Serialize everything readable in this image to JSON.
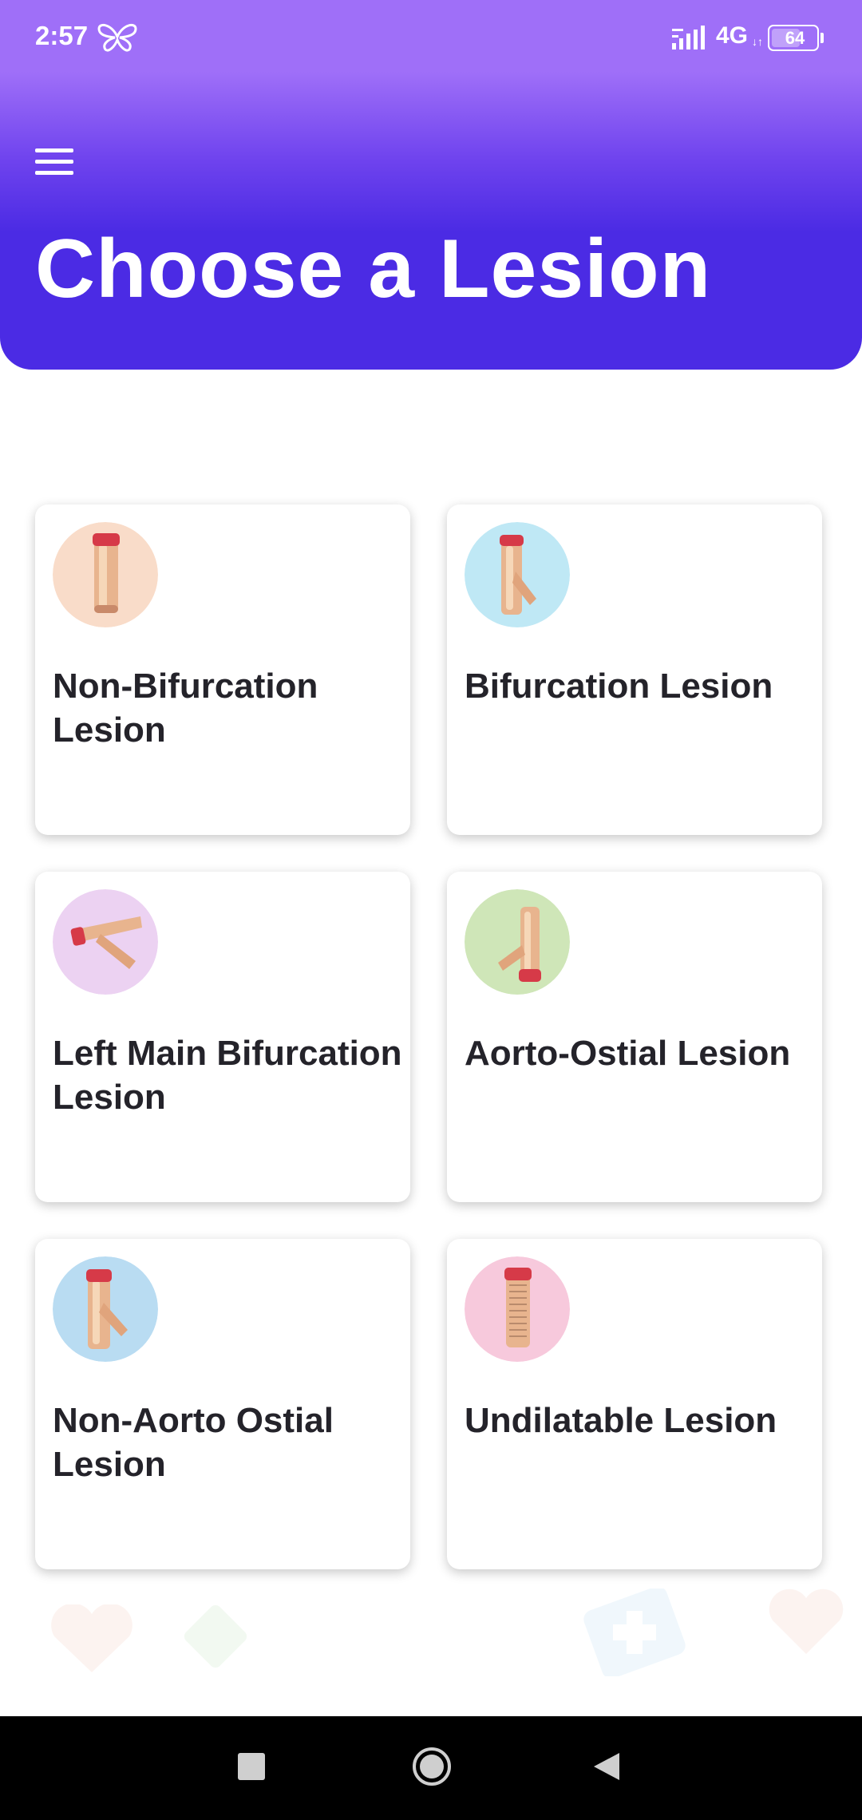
{
  "status_bar": {
    "time": "2:57",
    "network": "4G",
    "network_sub": "↓↑",
    "battery_level": "64",
    "battery_fraction": 0.64
  },
  "header": {
    "menu_icon": "hamburger-menu-icon",
    "title": "Choose a Lesion",
    "gradient_top": "#9f6ff8",
    "gradient_bottom": "#4b2be4"
  },
  "lesions": [
    {
      "label": "Non-Bifurcation Lesion",
      "icon": "straight-vessel-icon",
      "icon_bg": "#f9dcc9"
    },
    {
      "label": "Bifurcation Lesion",
      "icon": "bifurcation-vessel-icon",
      "icon_bg": "#bfe8f5"
    },
    {
      "label": "Left Main Bifurcation Lesion",
      "icon": "left-main-vessel-icon",
      "icon_bg": "#ecd2f2"
    },
    {
      "label": "Aorto-Ostial Lesion",
      "icon": "aorto-ostial-vessel-icon",
      "icon_bg": "#cfe6b8"
    },
    {
      "label": "Non-Aorto Ostial Lesion",
      "icon": "non-aorto-ostial-vessel-icon",
      "icon_bg": "#b9dcf2"
    },
    {
      "label": "Undilatable Lesion",
      "icon": "undilatable-vessel-icon",
      "icon_bg": "#f7c9dc"
    }
  ],
  "nav_bar": {
    "recents_icon": "square-recents-icon",
    "home_icon": "circle-home-icon",
    "back_icon": "triangle-back-icon"
  }
}
